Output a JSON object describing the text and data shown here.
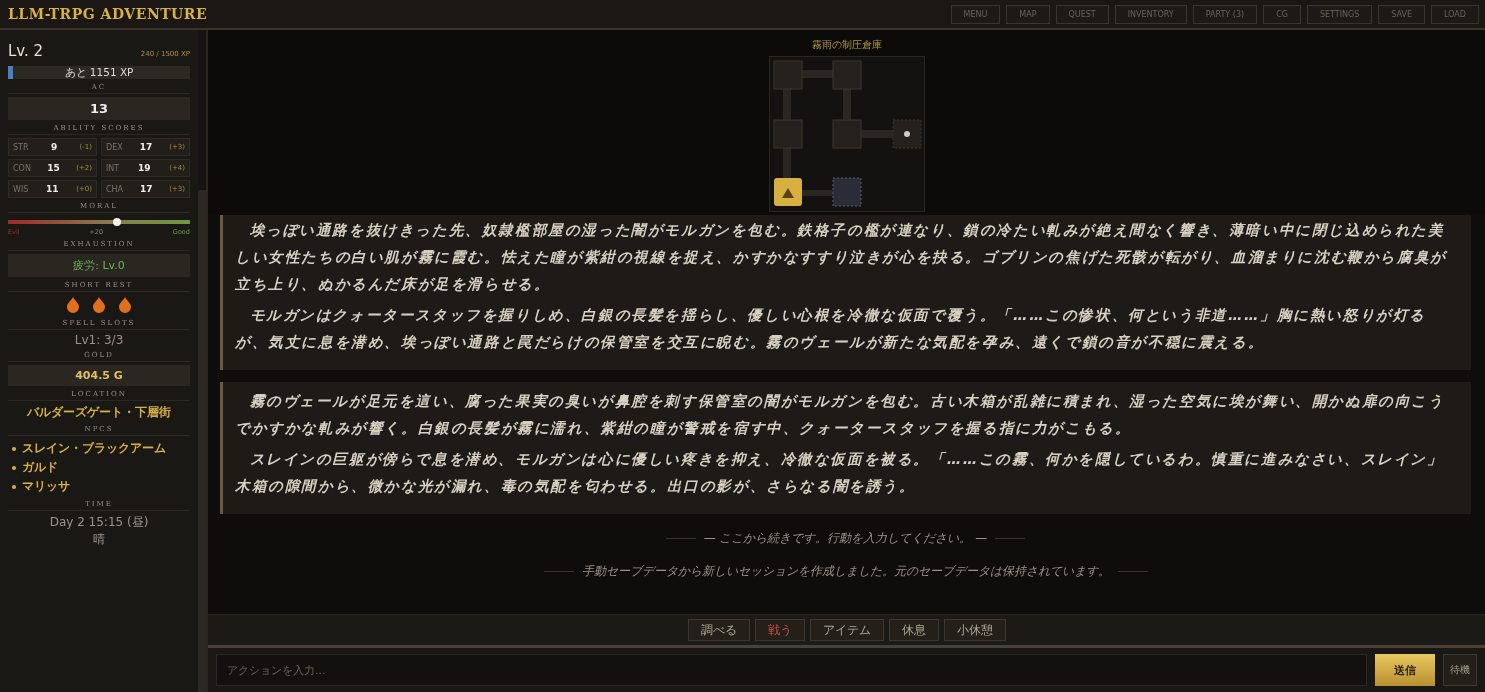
{
  "app": {
    "title": "LLM-TRPG ADVENTURE"
  },
  "nav": [
    "MENU",
    "MAP",
    "QUEST",
    "INVENTORY",
    "PARTY (3)",
    "CG",
    "SETTINGS",
    "SAVE",
    "LOAD"
  ],
  "sidebar": {
    "level": "Lv. 2",
    "xp": "240 / 1500 XP",
    "xp_bar": {
      "level": 0.03,
      "label": "あと 1151 XP"
    },
    "ac": {
      "heading": "AC",
      "value": "13"
    },
    "abilities": {
      "heading": "ABILITY SCORES",
      "items": [
        {
          "name": "STR",
          "score": "9",
          "mod": "(-1)"
        },
        {
          "name": "DEX",
          "score": "17",
          "mod": "(+3)"
        },
        {
          "name": "CON",
          "score": "15",
          "mod": "(+2)"
        },
        {
          "name": "INT",
          "score": "19",
          "mod": "(+4)"
        },
        {
          "name": "WIS",
          "score": "11",
          "mod": "(+0)"
        },
        {
          "name": "CHA",
          "score": "17",
          "mod": "(+3)"
        }
      ]
    },
    "moral": {
      "heading": "MORAL",
      "level": 0.6,
      "min": "Evil",
      "value": "+20",
      "max": "Good"
    },
    "exhaustion": {
      "heading": "EXHAUSTION",
      "value": "疲労: Lv.0"
    },
    "short_rest": {
      "heading": "SHORT REST",
      "charges": [
        {
          "available": true
        },
        {
          "available": true
        },
        {
          "available": true
        }
      ]
    },
    "spell_slots": {
      "heading": "SPELL SLOTS",
      "value": "Lv1: 3/3"
    },
    "gold": {
      "heading": "GOLD",
      "value": "404.5 G"
    },
    "location": {
      "heading": "LOCATION",
      "value": "バルダーズゲート・下層街"
    },
    "npcs": {
      "heading": "NPCS",
      "items": [
        "スレイン・ブラックアーム",
        "ガルド",
        "マリッサ"
      ]
    },
    "time": {
      "heading": "TIME",
      "value": "Day 2 15:15 (昼)",
      "weather": "晴"
    }
  },
  "map": {
    "title": "霧雨の制圧倉庫"
  },
  "story": [
    {
      "paragraphs": [
        "埃っぽい通路を抜けきった先、奴隷檻部屋の湿った闇がモルガンを包む。鉄格子の檻が連なり、鎖の冷たい軋みが絶え間なく響き、薄暗い中に閉じ込められた美しい女性たちの白い肌が霧に霞む。怯えた瞳が紫紺の視線を捉え、かすかなすすり泣きが心を抉る。ゴブリンの焦げた死骸が転がり、血溜まりに沈む鞭から腐臭が立ち上り、ぬかるんだ床が足を滑らせる。",
        "モルガンはクォータースタッフを握りしめ、白銀の長髪を揺らし、優しい心根を冷徹な仮面で覆う。「……この惨状、何という非道……」胸に熱い怒りが灯るが、気丈に息を潜め、埃っぽい通路と罠だらけの保管室を交互に睨む。霧のヴェールが新たな気配を孕み、遠くで鎖の音が不穏に震える。"
      ]
    },
    {
      "paragraphs": [
        "霧のヴェールが足元を這い、腐った果実の臭いが鼻腔を刺す保管室の闇がモルガンを包む。古い木箱が乱雑に積まれ、湿った空気に埃が舞い、開かぬ扉の向こうでかすかな軋みが響く。白銀の長髪が霧に濡れ、紫紺の瞳が警戒を宿す中、クォータースタッフを握る指に力がこもる。",
        "スレインの巨躯が傍らで息を潜め、モルガンは心に優しい疼きを抑え、冷徹な仮面を被る。「……この霧、何かを隠しているわ。慎重に進みなさい、スレイン」木箱の隙間から、微かな光が漏れ、毒の気配を匂わせる。出口の影が、さらなる闇を誘う。"
      ]
    }
  ],
  "system_messages": [
    "— ここから続きです。行動を入力してください。 —",
    "手動セーブデータから新しいセッションを作成しました。元のセーブデータは保持されています。"
  ],
  "quick_actions": [
    {
      "label": "調べる",
      "kind": "normal"
    },
    {
      "label": "戦う",
      "kind": "danger"
    },
    {
      "label": "アイテム",
      "kind": "normal"
    },
    {
      "label": "休息",
      "kind": "normal"
    },
    {
      "label": "小休憩",
      "kind": "normal"
    }
  ],
  "input": {
    "placeholder": "アクションを入力...",
    "send": "送信",
    "extra": "待機"
  }
}
